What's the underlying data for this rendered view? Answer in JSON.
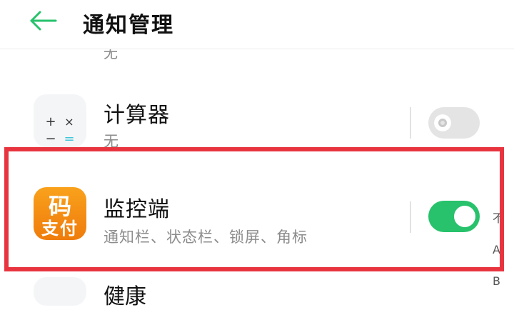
{
  "header": {
    "title": "通知管理",
    "back_icon": "arrow-left-icon",
    "accent": "#27c26b"
  },
  "list": {
    "partial_top_subtitle": "无",
    "items": [
      {
        "name": "计算器",
        "subtitle": "无",
        "icon": "calculator-icon",
        "enabled": false,
        "calc_symbols": [
          "+",
          "×",
          "−",
          "="
        ]
      },
      {
        "name": "监控端",
        "subtitle": "通知栏、状态栏、锁屏、角标",
        "icon": "mazhifu-app-icon",
        "icon_text_top": "码",
        "icon_text_bottom": "支付",
        "enabled": true
      }
    ],
    "partial_bottom_name": "健康"
  },
  "index_bar": [
    "不",
    "A",
    "B"
  ],
  "colors": {
    "toggle_on": "#27c26b",
    "toggle_off": "#e4e4e4",
    "highlight": "#e8343f",
    "app_icon_orange": "#f38a12"
  }
}
